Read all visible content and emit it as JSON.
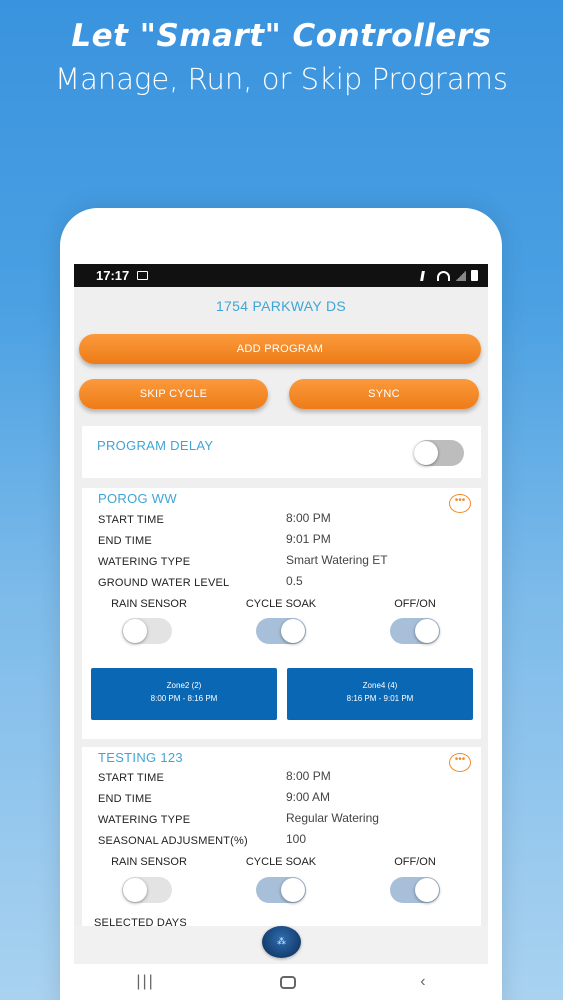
{
  "promo": {
    "headline": "Let \"Smart\" Controllers",
    "subheadline": "Manage, Run, or Skip Programs"
  },
  "statusbar": {
    "time": "17:17"
  },
  "screen_title": "1754 PARKWAY DS",
  "buttons": {
    "add_program": "ADD PROGRAM",
    "skip_cycle": "SKIP CYCLE",
    "sync": "SYNC"
  },
  "program_delay": {
    "label": "PROGRAM DELAY",
    "enabled": false
  },
  "programs": [
    {
      "name": "POROG WW",
      "rows": [
        {
          "label": "START TIME",
          "value": "8:00 PM"
        },
        {
          "label": "END TIME",
          "value": "9:01 PM"
        },
        {
          "label": "WATERING TYPE",
          "value": "Smart Watering ET"
        },
        {
          "label": "GROUND WATER LEVEL",
          "value": "0.5"
        }
      ],
      "toggles": [
        {
          "label": "RAIN SENSOR",
          "on": false
        },
        {
          "label": "CYCLE SOAK",
          "on": true
        },
        {
          "label": "OFF/ON",
          "on": true
        }
      ],
      "zones": [
        {
          "name": "Zone2 (2)",
          "time": "8:00 PM - 8:16 PM"
        },
        {
          "name": "Zone4 (4)",
          "time": "8:16 PM - 9:01 PM"
        }
      ]
    },
    {
      "name": "TESTING 123",
      "rows": [
        {
          "label": "START TIME",
          "value": "8:00 PM"
        },
        {
          "label": "END TIME",
          "value": "9:00 AM"
        },
        {
          "label": "WATERING TYPE",
          "value": "Regular Watering"
        },
        {
          "label": "SEASONAL ADJUSMENT(%)",
          "value": "100"
        }
      ],
      "toggles": [
        {
          "label": "RAIN SENSOR",
          "on": false
        },
        {
          "label": "CYCLE SOAK",
          "on": true
        },
        {
          "label": "OFF/ON",
          "on": true
        }
      ],
      "selected_days_label": "SELECTED DAYS"
    }
  ],
  "icons": {
    "more": "more-options-icon",
    "logo": "app-logo-icon",
    "nav_recents": "recents-icon",
    "nav_home": "home-icon",
    "nav_back": "back-icon"
  },
  "colors": {
    "accent_orange": "#ee7b18",
    "title_blue": "#3fa5d6",
    "zone_blue": "#0a67b4",
    "toggle_on": "#a7bfd8"
  }
}
